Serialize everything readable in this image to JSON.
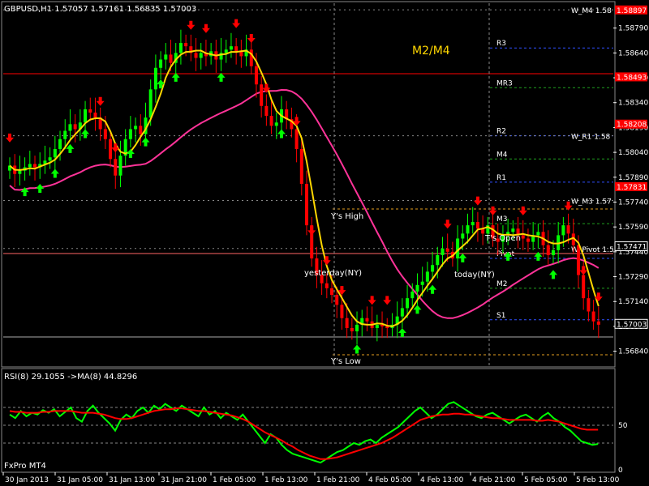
{
  "symbol_header": "GBPUSD,H1  1.57057 1.57161 1.56835 1.57003",
  "annotations": {
    "m2m4": "M2/M4",
    "yhigh": "Y's High",
    "ylow": "Y's Low",
    "yesterday": "yesterday(NY)",
    "today": "today(NY)",
    "tsopen": "T's Open",
    "pivot_prefix": "W"
  },
  "colors": {
    "bull": "#00ff00",
    "bear": "#ff0000",
    "ma_fast": "#ffd700",
    "ma_slow": "#ff3399",
    "rsi": "#00ff00",
    "rsi_ma": "#ff0000",
    "grid": "#808080"
  },
  "levels": [
    {
      "name": "R3",
      "price": 1.5867
    },
    {
      "name": "MR3",
      "price": 1.5843
    },
    {
      "name": "R2",
      "price": 1.5814
    },
    {
      "name": "M4",
      "price": 1.58
    },
    {
      "name": "R1",
      "price": 1.5786
    },
    {
      "name": "M3",
      "price": 1.5761
    },
    {
      "name": "Pivot",
      "price": 1.574
    },
    {
      "name": "M2",
      "price": 1.5722
    },
    {
      "name": "S1",
      "price": 1.5703
    }
  ],
  "weekly_labels": [
    {
      "name": "W_M4 1.58",
      "price": 1.589
    },
    {
      "name": "W_R1 1.58",
      "price": 1.5814
    },
    {
      "name": "W_M3 1.57",
      "price": 1.5775
    },
    {
      "name": "W_Pivot 1.5",
      "price": 1.5746
    }
  ],
  "price_tags": [
    {
      "text": "1.58897",
      "price": 1.58897,
      "color": "#ff0000"
    },
    {
      "text": "1.58493",
      "price": 1.58493,
      "color": "#ff0000"
    },
    {
      "text": "1.58208",
      "price": 1.58208,
      "color": "#ff0000"
    },
    {
      "text": "1.57831",
      "price": 1.57831,
      "color": "#ff0000"
    },
    {
      "text": "1.57471",
      "price": 1.57471,
      "color": "#ffffff"
    },
    {
      "text": "1.57003",
      "price": 1.57003,
      "color": "#ffffff"
    }
  ],
  "rsi_panel": {
    "title": "RSI(8) 29.1055  ->MA(8) 44.8296",
    "footer": "FxPro MT4",
    "ticks": [
      "50",
      "0"
    ]
  },
  "chart_data": [
    {
      "type": "candlestick",
      "title": "GBPUSD,H1",
      "ylim": [
        1.5676,
        1.5893
      ],
      "y_ticks": [
        "1.58790",
        "1.58640",
        "1.58490",
        "1.58340",
        "1.58190",
        "1.58040",
        "1.57890",
        "1.57740",
        "1.57590",
        "1.57440",
        "1.57290",
        "1.57140",
        "1.56990",
        "1.56840"
      ],
      "x_ticks": [
        "30 Jan 2013",
        "31 Jan 05:00",
        "31 Jan 13:00",
        "31 Jan 21:00",
        "1 Feb 05:00",
        "1 Feb 13:00",
        "1 Feb 21:00",
        "4 Feb 05:00",
        "4 Feb 13:00",
        "4 Feb 21:00",
        "5 Feb 05:00",
        "5 Feb 13:00"
      ],
      "closes": [
        1.5796,
        1.5791,
        1.5793,
        1.5795,
        1.5797,
        1.5795,
        1.5797,
        1.5799,
        1.5801,
        1.5806,
        1.5812,
        1.5817,
        1.5821,
        1.5818,
        1.5822,
        1.583,
        1.5828,
        1.5825,
        1.5818,
        1.5812,
        1.58,
        1.579,
        1.5802,
        1.5812,
        1.5818,
        1.582,
        1.5815,
        1.5825,
        1.5842,
        1.5855,
        1.586,
        1.5863,
        1.5858,
        1.5864,
        1.587,
        1.5868,
        1.5864,
        1.5861,
        1.5864,
        1.5862,
        1.5865,
        1.586,
        1.5864,
        1.5866,
        1.5868,
        1.5865,
        1.5862,
        1.5866,
        1.5856,
        1.5845,
        1.5832,
        1.5826,
        1.582,
        1.5822,
        1.583,
        1.5824,
        1.5818,
        1.5806,
        1.5785,
        1.576,
        1.574,
        1.573,
        1.5725,
        1.5722,
        1.5718,
        1.5712,
        1.5704,
        1.5698,
        1.5696,
        1.57,
        1.5704,
        1.5702,
        1.5698,
        1.57,
        1.5699,
        1.5698,
        1.57,
        1.5705,
        1.571,
        1.5716,
        1.572,
        1.5724,
        1.5726,
        1.5732,
        1.5736,
        1.5742,
        1.5746,
        1.5744,
        1.574,
        1.5752,
        1.5755,
        1.576,
        1.5762,
        1.5758,
        1.5755,
        1.576,
        1.5752,
        1.575,
        1.5754,
        1.5756,
        1.5758,
        1.5754,
        1.5752,
        1.575,
        1.5754,
        1.5756,
        1.5748,
        1.5742,
        1.5745,
        1.5754,
        1.576,
        1.5755,
        1.5748,
        1.573,
        1.5716,
        1.5708,
        1.5702,
        1.57
      ]
    },
    {
      "type": "line",
      "title": "RSI(8)",
      "ylim": [
        0,
        100
      ],
      "series": [
        {
          "name": "RSI(8)",
          "values": [
            62,
            58,
            66,
            60,
            64,
            62,
            67,
            64,
            68,
            60,
            65,
            70,
            58,
            54,
            66,
            72,
            64,
            58,
            52,
            44,
            56,
            62,
            58,
            66,
            70,
            64,
            72,
            68,
            74,
            70,
            66,
            72,
            68,
            64,
            60,
            70,
            62,
            66,
            58,
            64,
            60,
            56,
            62,
            54,
            46,
            38,
            30,
            40,
            36,
            28,
            22,
            18,
            16,
            14,
            12,
            10,
            8,
            12,
            16,
            20,
            22,
            26,
            30,
            28,
            32,
            34,
            30,
            36,
            40,
            44,
            48,
            54,
            60,
            66,
            70,
            64,
            58,
            62,
            68,
            74,
            76,
            72,
            68,
            64,
            60,
            58,
            62,
            64,
            60,
            56,
            52,
            56,
            60,
            62,
            58,
            54,
            60,
            64,
            58,
            54,
            48,
            44,
            38,
            32,
            30,
            28,
            29
          ]
        },
        {
          "name": "MA(8)",
          "values": [
            66,
            65,
            65,
            64,
            64,
            64,
            65,
            65,
            66,
            66,
            66,
            66,
            65,
            64,
            64,
            64,
            63,
            62,
            60,
            58,
            57,
            57,
            58,
            60,
            62,
            64,
            66,
            67,
            68,
            68,
            69,
            69,
            68,
            67,
            66,
            66,
            65,
            64,
            63,
            62,
            61,
            59,
            57,
            54,
            50,
            46,
            42,
            39,
            36,
            33,
            29,
            26,
            22,
            19,
            16,
            14,
            12,
            12,
            13,
            14,
            16,
            18,
            20,
            22,
            24,
            26,
            28,
            30,
            33,
            36,
            40,
            44,
            48,
            52,
            56,
            58,
            60,
            61,
            62,
            62,
            63,
            63,
            62,
            62,
            61,
            60,
            59,
            58,
            58,
            57,
            56,
            56,
            56,
            56,
            56,
            55,
            55,
            56,
            55,
            54,
            52,
            50,
            48,
            46,
            45,
            45,
            45
          ]
        }
      ]
    }
  ]
}
